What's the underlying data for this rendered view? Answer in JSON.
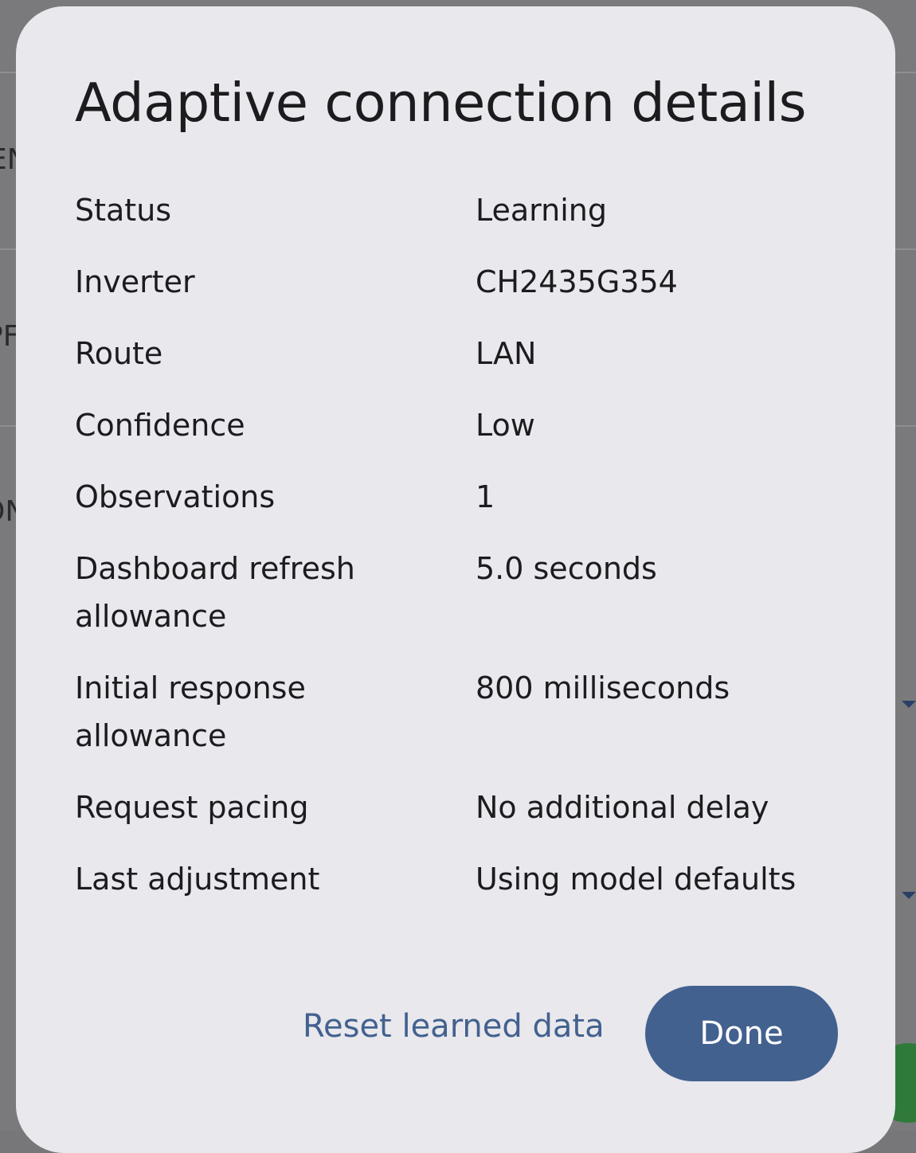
{
  "dialog": {
    "title": "Adaptive connection details",
    "rows": [
      {
        "label": "Status",
        "value": "Learning"
      },
      {
        "label": "Inverter",
        "value": "CH2435G354"
      },
      {
        "label": "Route",
        "value": "LAN"
      },
      {
        "label": "Confidence",
        "value": "Low"
      },
      {
        "label": "Observations",
        "value": "1"
      },
      {
        "label": "Dashboard refresh allowance",
        "value": "5.0 seconds"
      },
      {
        "label": "Initial response allowance",
        "value": "800 milliseconds"
      },
      {
        "label": "Request pacing",
        "value": "No additional delay"
      },
      {
        "label": "Last adjustment",
        "value": "Using model defaults"
      }
    ],
    "reset_label": "Reset learned data",
    "done_label": "Done"
  },
  "background": {
    "fragments": [
      "EN",
      "PF",
      "ON"
    ],
    "accent_color": "#43618f",
    "scrim_color": "#77777a",
    "dialog_color": "#e8e8ed"
  }
}
